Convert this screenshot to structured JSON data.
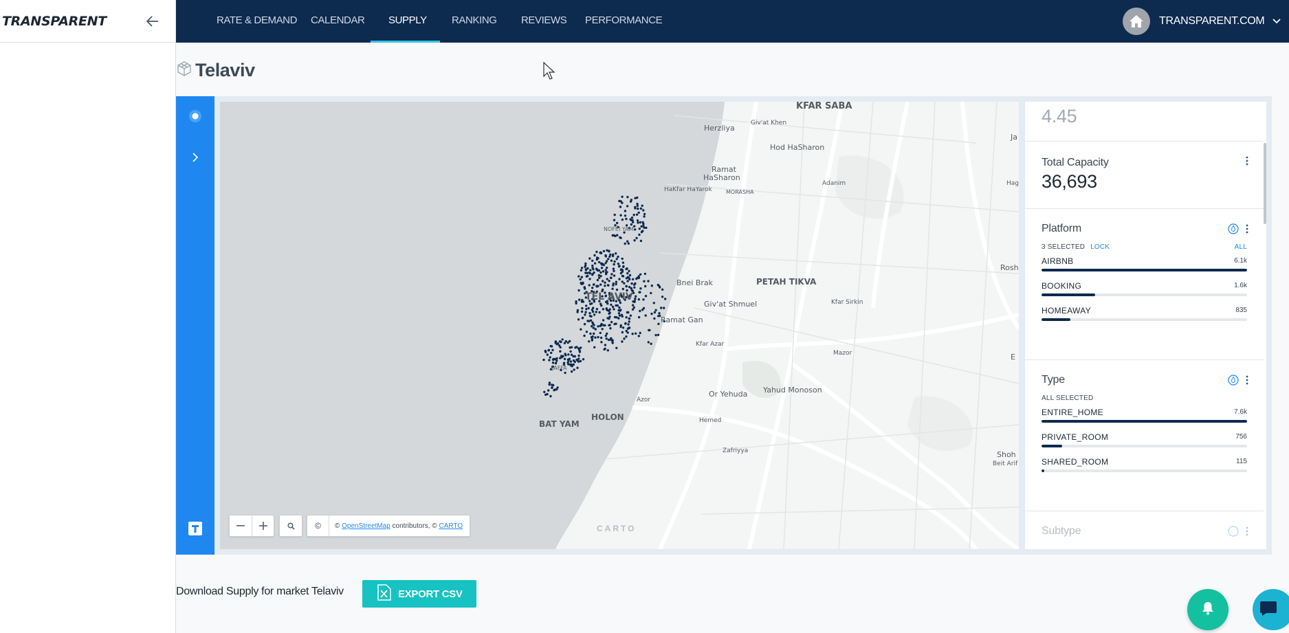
{
  "app": {
    "logo": "TRANSPARENT"
  },
  "nav": {
    "tabs": [
      {
        "label": "RATE & DEMAND"
      },
      {
        "label": "CALENDAR"
      },
      {
        "label": "SUPPLY"
      },
      {
        "label": "RANKING"
      },
      {
        "label": "REVIEWS"
      },
      {
        "label": "PERFORMANCE"
      }
    ],
    "active_tab": "SUPPLY",
    "account_name": "TRANSPARENT.COM"
  },
  "page": {
    "title": "Telaviv"
  },
  "map": {
    "labels": {
      "kfar_saba": "KFAR SABA",
      "herzliya": "Herzliya",
      "givat_khen": "Giv'at Khen",
      "hod_hasharon": "Hod HaSharon",
      "ramat_hasharon_1": "Ramat",
      "ramat_hasharon_2": "HaSharon",
      "hakfar_hayarok": "HaKfar HaYarok",
      "morasha": "MORASHA",
      "adanim": "Adanim",
      "nofei_yam": "NOFEI YAM",
      "bnei_brak": "Bnei Brak",
      "petah_tikva": "PETAH TIKVA",
      "tel_aviv": "TEL AVIV",
      "givat_shmuel": "Giv'at Shmuel",
      "ramat_gan": "Ramat Gan",
      "kfar_sirkin": "Kfar Sirkin",
      "kfar_azar": "Kfar Azar",
      "mazor": "Mazor",
      "jaffa": "JAFFA",
      "or_yehuda": "Or Yehuda",
      "yahud_monoson": "Yahud Monoson",
      "azor": "Azor",
      "holon": "HOLON",
      "bat_yam": "BAT YAM",
      "hemed": "Hemed",
      "zafriyya": "Zafriyya",
      "shoham": "Shoh",
      "beit_arif": "Beit Arif",
      "rosh": "Rosh",
      "hag": "Hag",
      "ja": "Ja",
      "e": "E"
    },
    "attribution": {
      "osm": "OpenStreetMap",
      "contributors": "contributors, ©",
      "carto": "CARTO",
      "copyright": "©"
    },
    "watermark": "CARTO"
  },
  "widgets": {
    "avg_value": "4.45",
    "total_capacity": {
      "label": "Total Capacity",
      "value": "36,693"
    },
    "platform": {
      "label": "Platform",
      "selected": "3 SELECTED",
      "lock": "LOCK",
      "all": "ALL",
      "items": [
        {
          "name": "AIRBNB",
          "value": "6.1k",
          "fraction": 1.0
        },
        {
          "name": "BOOKING",
          "value": "1.6k",
          "fraction": 0.26
        },
        {
          "name": "HOMEAWAY",
          "value": "835",
          "fraction": 0.14
        }
      ]
    },
    "type": {
      "label": "Type",
      "selected": "ALL SELECTED",
      "items": [
        {
          "name": "ENTIRE_HOME",
          "value": "7.6k",
          "fraction": 1.0
        },
        {
          "name": "PRIVATE_ROOM",
          "value": "756",
          "fraction": 0.1
        },
        {
          "name": "SHARED_ROOM",
          "value": "115",
          "fraction": 0.015
        }
      ]
    },
    "subtype": {
      "label": "Subtype"
    }
  },
  "footer": {
    "download_text": "Download Supply for market Telaviv",
    "export_label": "EXPORT CSV"
  },
  "colors": {
    "nav": "#0d2a4f",
    "rail": "#1e88f0",
    "accent": "#33c2e5",
    "export": "#16c2c2",
    "dots": "#0d2a4f"
  }
}
